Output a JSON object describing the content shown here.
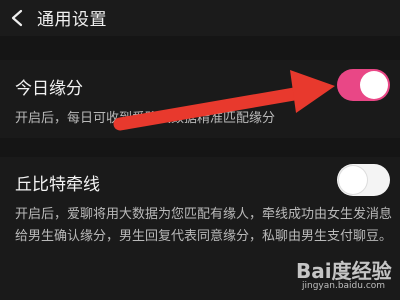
{
  "header": {
    "title": "通用设置",
    "back_icon": "chevron-left-icon"
  },
  "settings": [
    {
      "title": "今日缘分",
      "description": "开启后，每日可收到爱聊大数据精准匹配缘分",
      "enabled": true
    },
    {
      "title": "丘比特牵线",
      "description": "开启后，爱聊将用大数据为您匹配有缘人，牵线成功由女生发消息给男生确认缘分，男生回复代表同意缘分，私聊由男生支付聊豆。",
      "enabled": false
    }
  ],
  "colors": {
    "toggle_on": "#e94786",
    "arrow": "#e8392d",
    "background": "#151515"
  },
  "watermark": {
    "logo": "Bai度经验",
    "url": "jingyan.baidu.com"
  }
}
